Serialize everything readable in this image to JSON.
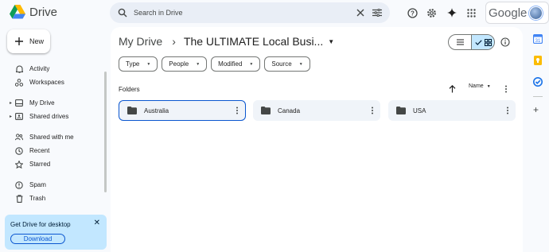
{
  "app": {
    "name": "Drive",
    "search_placeholder": "Search in Drive",
    "google_label": "Google"
  },
  "sidebar": {
    "new_label": "New",
    "items": [
      {
        "label": "Activity",
        "icon": "bell-icon"
      },
      {
        "label": "Workspaces",
        "icon": "workspaces-icon"
      },
      {
        "label": "My Drive",
        "icon": "my-drive-icon"
      },
      {
        "label": "Shared drives",
        "icon": "shared-drives-icon"
      },
      {
        "label": "Shared with me",
        "icon": "people-icon"
      },
      {
        "label": "Recent",
        "icon": "clock-icon"
      },
      {
        "label": "Starred",
        "icon": "star-icon"
      },
      {
        "label": "Spam",
        "icon": "spam-icon"
      },
      {
        "label": "Trash",
        "icon": "trash-icon"
      }
    ]
  },
  "promo": {
    "title": "Get Drive for desktop",
    "button": "Download"
  },
  "breadcrumb": {
    "root": "My Drive",
    "current": "The ULTIMATE Local Busi..."
  },
  "filters": [
    "Type",
    "People",
    "Modified",
    "Source"
  ],
  "section": {
    "title": "Folders",
    "sort_label": "Name"
  },
  "folders": [
    {
      "name": "Australia",
      "selected": true
    },
    {
      "name": "Canada",
      "selected": false
    },
    {
      "name": "USA",
      "selected": false
    }
  ],
  "colors": {
    "accent": "#0b57d0",
    "selected_bg": "#c2e7ff",
    "surface": "#f8fafd"
  }
}
